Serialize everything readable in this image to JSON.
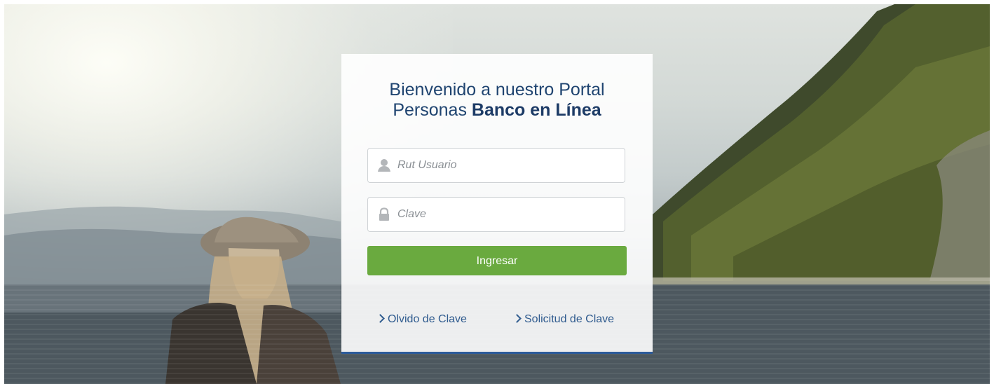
{
  "login": {
    "title_line1": "Bienvenido a nuestro Portal",
    "title_line2_normal": "Personas ",
    "title_line2_bold": "Banco en Línea",
    "user_placeholder": "Rut Usuario",
    "user_icon": "user-icon",
    "password_placeholder": "Clave",
    "password_icon": "lock-icon",
    "submit_label": "Ingresar",
    "forgot_label": "Olvido de Clave",
    "request_label": "Solicitud de Clave"
  },
  "colors": {
    "accent_green": "#6aaa3f",
    "brand_blue": "#1f4470",
    "card_border": "#2d5b9a"
  }
}
